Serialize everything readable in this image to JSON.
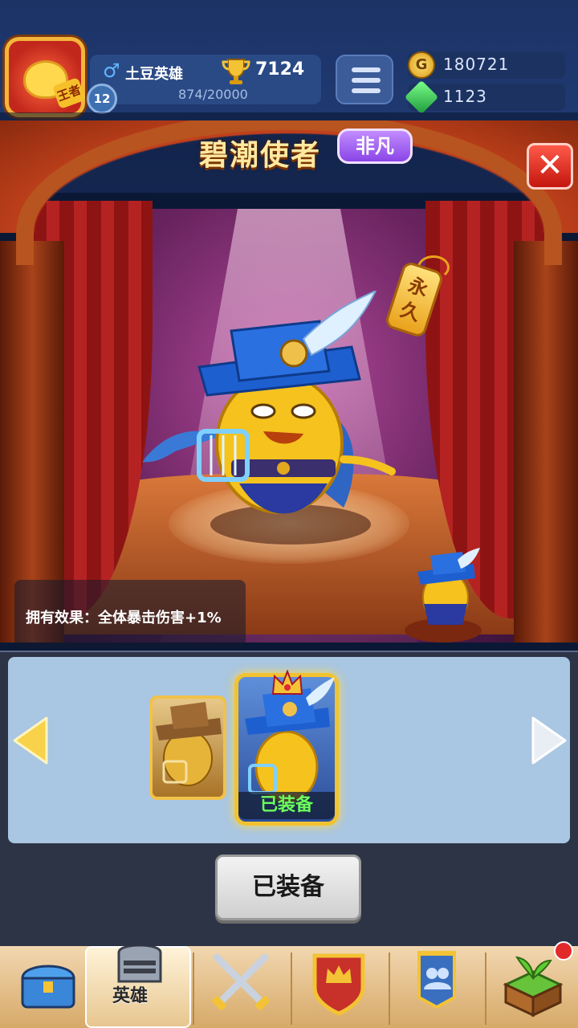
{
  "player": {
    "name": "土豆英雄",
    "level": "12",
    "trophies": "7124",
    "experience": "874/20000",
    "avatar_tag": "王者"
  },
  "currency": {
    "coins": "180721",
    "gems": "1123",
    "coin_symbol": "G"
  },
  "hero_detail": {
    "title": "碧潮使者",
    "rarity": "非凡",
    "permanent_tag": "永久",
    "effect_text": "拥有效果：全体暴击伤害+1%"
  },
  "skins": {
    "selected_label": "已装备",
    "equip_button_label": "已装备"
  },
  "nav": {
    "items": [
      {
        "icon": "treasure-chest-icon"
      },
      {
        "icon": "knight-helmet-icon",
        "label": "英雄"
      },
      {
        "icon": "crossed-swords-icon"
      },
      {
        "icon": "crown-shield-icon"
      },
      {
        "icon": "guild-banner-icon"
      },
      {
        "icon": "sprout-block-icon"
      }
    ]
  },
  "colors": {
    "rarity_purple": "#a466f2",
    "equipped_green": "#6cff5a",
    "close_red": "#e0291c"
  }
}
